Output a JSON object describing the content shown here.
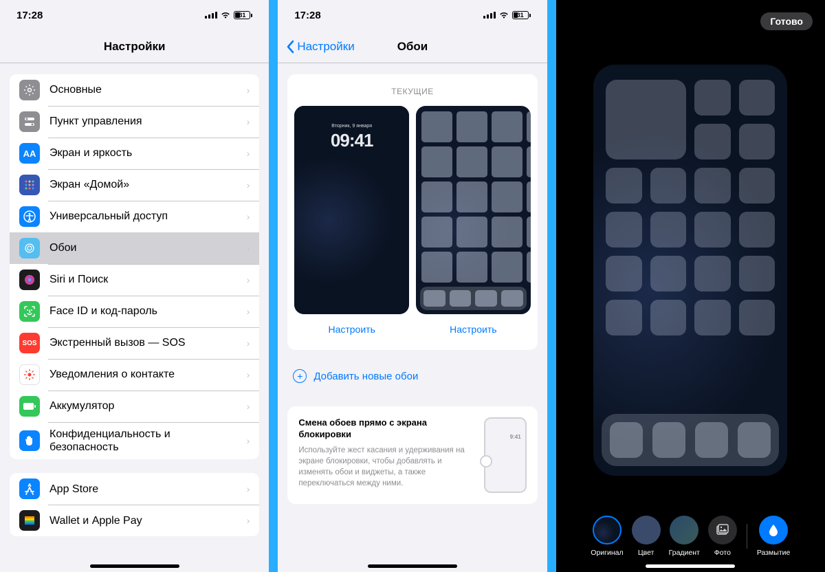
{
  "status": {
    "time": "17:28",
    "battery": "31"
  },
  "screen1": {
    "title": "Настройки",
    "groups": [
      [
        {
          "icon": "gear",
          "bg": "#8e8e93",
          "label": "Основные"
        },
        {
          "icon": "switches",
          "bg": "#8e8e93",
          "label": "Пункт управления"
        },
        {
          "icon": "AA",
          "bg": "#0a84ff",
          "label": "Экран и яркость"
        },
        {
          "icon": "grid",
          "bg": "#3658b4",
          "label": "Экран «Домой»"
        },
        {
          "icon": "accessibility",
          "bg": "#0a84ff",
          "label": "Универсальный доступ"
        },
        {
          "icon": "wallpaper",
          "bg": "#55bdf0",
          "label": "Обои",
          "selected": true
        },
        {
          "icon": "siri",
          "bg": "#1c1c1e",
          "label": "Siri и Поиск"
        },
        {
          "icon": "faceid",
          "bg": "#34c759",
          "label": "Face ID и код-пароль"
        },
        {
          "icon": "sos",
          "bg": "#ff3b30",
          "label": "Экстренный вызов — SOS"
        },
        {
          "icon": "exposure",
          "bg": "#ffffff",
          "label": "Уведомления о контакте"
        },
        {
          "icon": "battery",
          "bg": "#34c759",
          "label": "Аккумулятор"
        },
        {
          "icon": "hand",
          "bg": "#0a84ff",
          "label": "Конфиденциальность и безопасность"
        }
      ],
      [
        {
          "icon": "appstore",
          "bg": "#0a84ff",
          "label": "App Store"
        },
        {
          "icon": "wallet",
          "bg": "#1c1c1e",
          "label": "Wallet и Apple Pay"
        }
      ]
    ]
  },
  "screen2": {
    "back": "Настройки",
    "title": "Обои",
    "section_label": "ТЕКУЩИЕ",
    "lock_date": "Вторник, 9 января",
    "lock_time": "09:41",
    "customize": "Настроить",
    "add_new": "Добавить новые обои",
    "info_title": "Смена обоев прямо с экрана блокировки",
    "info_desc": "Используйте жест касания и удерживания на экране блокировки, чтобы добавлять и изменять обои и виджеты, а также переключаться между ними."
  },
  "screen3": {
    "done": "Готово",
    "toolbar": {
      "original": "Оригинал",
      "color": "Цвет",
      "gradient": "Градиент",
      "photo": "Фото",
      "blur": "Размытие"
    }
  }
}
